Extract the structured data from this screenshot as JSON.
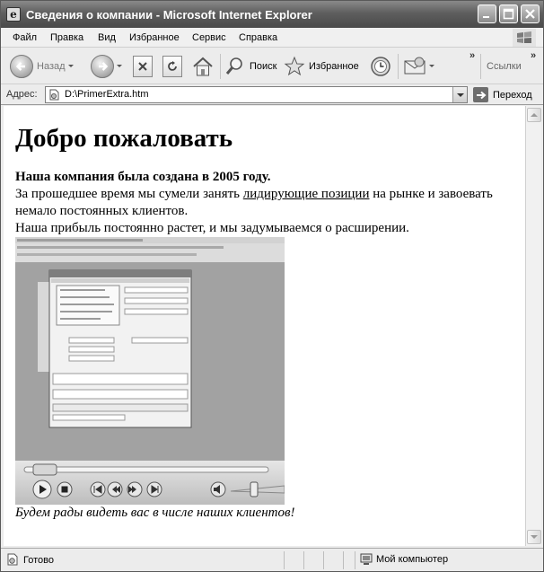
{
  "window": {
    "title": "Сведения о компании - Microsoft Internet Explorer"
  },
  "menu": {
    "items": [
      "Файл",
      "Правка",
      "Вид",
      "Избранное",
      "Сервис",
      "Справка"
    ]
  },
  "toolbar": {
    "back_label": "Назад",
    "search_label": "Поиск",
    "favorites_label": "Избранное",
    "links_label": "Ссылки",
    "more_glyph": "»"
  },
  "address": {
    "label": "Адрес:",
    "url": "D:\\PrimerExtra.htm",
    "go_label": "Переход"
  },
  "page": {
    "heading": "Добро пожаловать",
    "lead": "Наша компания была создана в 2005 году.",
    "para1_before": "За прошедшее время мы сумели занять ",
    "para1_link": "лидирующие позиции",
    "para1_after": " на рынке и завоевать немало постоянных клиентов.",
    "para2": "Наша прибыль постоянно растет, и мы задумываемся о расширении.",
    "footer_note": "Будем рады видеть вас в числе наших клиентов!"
  },
  "status": {
    "text": "Готово",
    "zone": "Мой компьютер"
  }
}
